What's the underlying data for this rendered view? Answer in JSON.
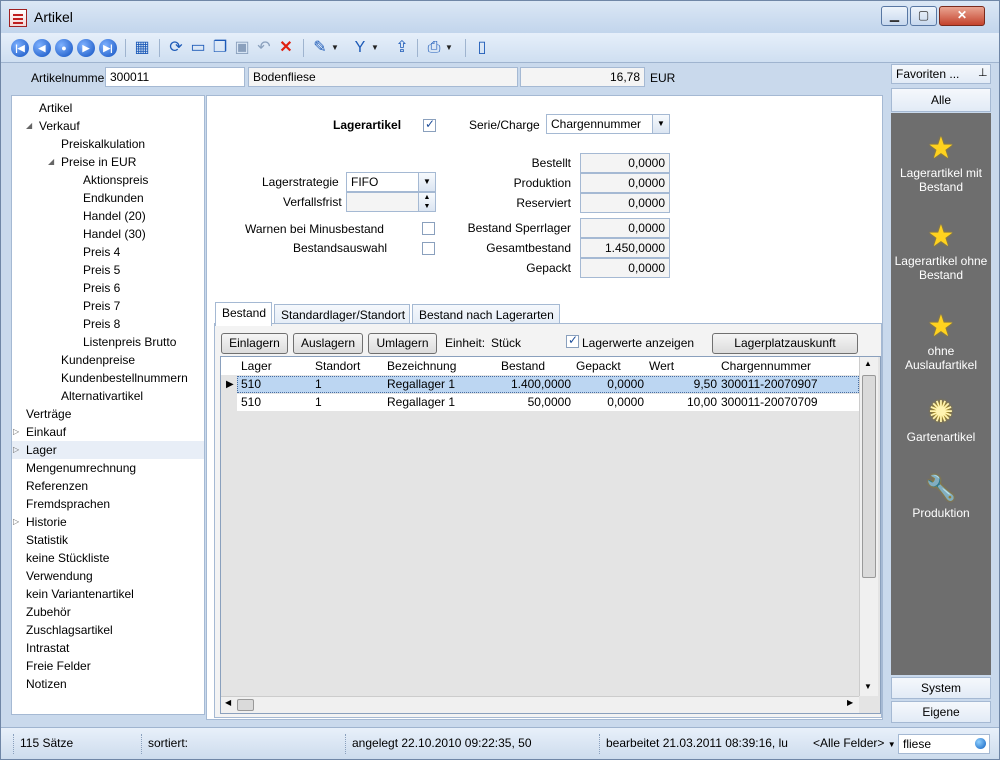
{
  "window": {
    "title": "Artikel",
    "min_label": "▁",
    "max_label": "▢",
    "close_label": "✕"
  },
  "toolbar": {
    "nav_buttons": [
      "first-record",
      "previous-record",
      "select-record",
      "next-record",
      "last-record"
    ],
    "icons": [
      "list-view-icon",
      "refresh-icon",
      "new-icon",
      "copy-icon",
      "save-icon",
      "undo-icon",
      "delete-icon",
      "wand-icon",
      "filter-icon",
      "export-icon",
      "print-icon",
      "door-icon"
    ]
  },
  "header": {
    "article_number_label": "Artikelnummer",
    "article_number": "300011",
    "description": "Bodenfliese",
    "price": "16,78",
    "currency": "EUR"
  },
  "tree": [
    {
      "label": "Artikel",
      "level": 1
    },
    {
      "label": "Verkauf",
      "level": 1,
      "expander": "open"
    },
    {
      "label": "Preiskalkulation",
      "level": 2
    },
    {
      "label": "Preise in EUR",
      "level": 2,
      "expander": "open"
    },
    {
      "label": "Aktionspreis",
      "level": 3
    },
    {
      "label": "Endkunden",
      "level": 3
    },
    {
      "label": "Handel (20)",
      "level": 3
    },
    {
      "label": "Handel (30)",
      "level": 3
    },
    {
      "label": "Preis 4",
      "level": 3
    },
    {
      "label": "Preis 5",
      "level": 3
    },
    {
      "label": "Preis 6",
      "level": 3
    },
    {
      "label": "Preis 7",
      "level": 3
    },
    {
      "label": "Preis 8",
      "level": 3
    },
    {
      "label": "Listenpreis Brutto",
      "level": 3
    },
    {
      "label": "Kundenpreise",
      "level": 2
    },
    {
      "label": "Kundenbestellnummern",
      "level": 2
    },
    {
      "label": "Alternativartikel",
      "level": 2
    },
    {
      "label": "Verträge",
      "level": 0
    },
    {
      "label": "Einkauf",
      "level": 0,
      "expander": "closed"
    },
    {
      "label": "Lager",
      "level": 0,
      "expander": "closed",
      "selected": true
    },
    {
      "label": "Mengenumrechnung",
      "level": 0
    },
    {
      "label": "Referenzen",
      "level": 0
    },
    {
      "label": "Fremdsprachen",
      "level": 0
    },
    {
      "label": "Historie",
      "level": 0,
      "expander": "closed"
    },
    {
      "label": "Statistik",
      "level": 0
    },
    {
      "label": "keine Stückliste",
      "level": 0
    },
    {
      "label": "Verwendung",
      "level": 0
    },
    {
      "label": "kein Variantenartikel",
      "level": 0
    },
    {
      "label": "Zubehör",
      "level": 0
    },
    {
      "label": "Zuschlagsartikel",
      "level": 0
    },
    {
      "label": "Intrastat",
      "level": 0
    },
    {
      "label": "Freie Felder",
      "level": 0
    },
    {
      "label": "Notizen",
      "level": 0
    }
  ],
  "stock": {
    "lagerartikel_label": "Lagerartikel",
    "lagerartikel_checked": true,
    "serie_label": "Serie/Charge",
    "serie_value": "Chargennummer",
    "strategie_label": "Lagerstrategie",
    "strategie_value": "FIFO",
    "verfallsfrist_label": "Verfallsfrist",
    "verfallsfrist_value": "",
    "warnen_label": "Warnen bei Minusbestand",
    "warnen_checked": false,
    "bestandsauswahl_label": "Bestandsauswahl",
    "bestandsauswahl_checked": false,
    "quantities": [
      {
        "label": "Bestellt",
        "value": "0,0000"
      },
      {
        "label": "Produktion",
        "value": "0,0000"
      },
      {
        "label": "Reserviert",
        "value": "0,0000"
      },
      {
        "label": "Bestand Sperrlager",
        "value": "0,0000"
      },
      {
        "label": "Gesamtbestand",
        "value": "1.450,0000"
      },
      {
        "label": "Gepackt",
        "value": "0,0000"
      }
    ]
  },
  "tabs": [
    "Bestand",
    "Standardlager/Standort",
    "Bestand nach Lagerarten"
  ],
  "panel": {
    "buttons": [
      "Einlagern",
      "Auslagern",
      "Umlagern"
    ],
    "unit_label": "Einheit:",
    "unit_value": "Stück",
    "show_values_label": "Lagerwerte anzeigen",
    "show_values_checked": true,
    "location_button": "Lagerplatzauskunft"
  },
  "grid": {
    "columns": [
      "Lager",
      "Standort",
      "Bezeichnung",
      "Bestand",
      "Gepackt",
      "Wert",
      "Chargennummer"
    ],
    "rows": [
      {
        "lager": "510",
        "standort": "1",
        "bezeichnung": "Regallager 1",
        "bestand": "1.400,0000",
        "gepackt": "0,0000",
        "wert": "9,50",
        "charge": "300011-20070907",
        "selected": true
      },
      {
        "lager": "510",
        "standort": "1",
        "bezeichnung": "Regallager 1",
        "bestand": "50,0000",
        "gepackt": "0,0000",
        "wert": "10,00",
        "charge": "300011-20070709"
      }
    ]
  },
  "favorites": {
    "header": "Favoriten ...",
    "pin": "⊥",
    "tab_all": "Alle",
    "items": [
      {
        "label": "Lagerartikel mit Bestand",
        "icon": "star-icon"
      },
      {
        "label": "Lagerartikel ohne Bestand",
        "icon": "star-icon"
      },
      {
        "label": "ohne Auslaufartikel",
        "icon": "star-icon"
      },
      {
        "label": "Gartenartikel",
        "icon": "flower-icon"
      },
      {
        "label": "Produktion",
        "icon": "wrench-icon"
      }
    ],
    "tab_system": "System",
    "tab_own": "Eigene"
  },
  "status": {
    "count": "115 Sätze",
    "sorted": "sortiert:",
    "created": "angelegt 22.10.2010 09:22:35, 50",
    "edited": "bearbeitet 21.03.2011 08:39:16, lu",
    "field_select": "<Alle Felder>",
    "search": "fliese"
  }
}
